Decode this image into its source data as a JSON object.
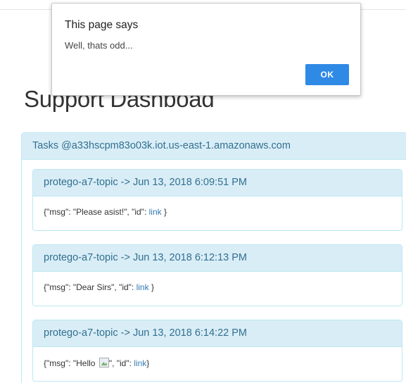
{
  "page": {
    "title": "Support Dashboad"
  },
  "tasks_panel": {
    "heading": "Tasks @a33hscpm83o03k.iot.us-east-1.amazonaws.com",
    "items": [
      {
        "heading": "protego-a7-topic -> Jun 13, 2018 6:09:51 PM",
        "body_prefix": "{\"msg\": \"Please asist!\", \"id\": ",
        "link": "link",
        "body_suffix": " }"
      },
      {
        "heading": "protego-a7-topic -> Jun 13, 2018 6:12:13 PM",
        "body_prefix": "{\"msg\": \"Dear Sirs\", \"id\": ",
        "link": "link",
        "body_suffix": " }"
      },
      {
        "heading": "protego-a7-topic -> Jun 13, 2018 6:14:22 PM",
        "body_prefix": "{\"msg\": \"Hello ",
        "body_middle": "\", \"id\": ",
        "link": "link",
        "body_suffix": "}"
      }
    ]
  },
  "dialog": {
    "title": "This page says",
    "message": "Well, thats odd...",
    "ok_label": "OK"
  },
  "colors": {
    "panel_heading_bg": "#d9edf7",
    "panel_border": "#bce8f1",
    "panel_heading_text": "#31708f",
    "link": "#337ab7",
    "ok_button": "#2f8ae6"
  }
}
